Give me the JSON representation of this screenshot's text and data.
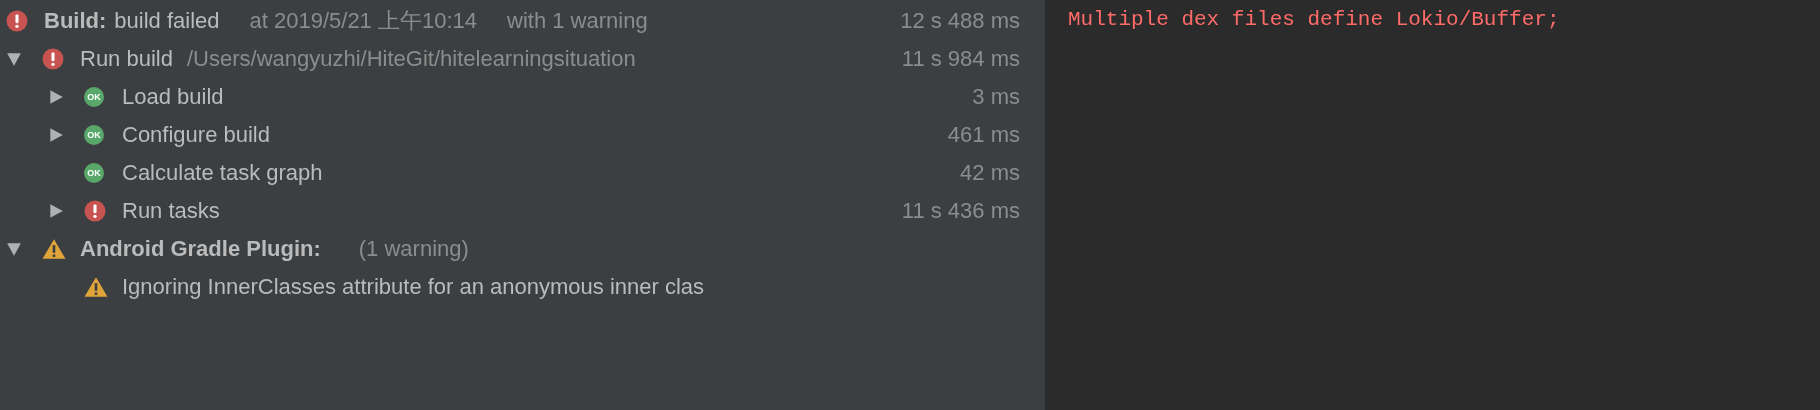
{
  "build_tree": {
    "kind": "error",
    "title": "Build:",
    "label": "build failed",
    "details": [
      "at 2019/5/21 上午10:14",
      "with 1 warning"
    ],
    "time": "12 s 488 ms",
    "children": [
      {
        "kind": "error",
        "expanded": true,
        "label": "Run build",
        "details": [
          "/Users/wangyuzhi/HiteGit/hitelearningsituation"
        ],
        "time": "11 s 984 ms",
        "children": [
          {
            "kind": "ok",
            "badge": "OK",
            "expanded": false,
            "label": "Load build",
            "time": "3 ms"
          },
          {
            "kind": "ok",
            "badge": "OK",
            "expanded": false,
            "label": "Configure build",
            "time": "461 ms"
          },
          {
            "kind": "ok",
            "badge": "OK",
            "label": "Calculate task graph",
            "time": "42 ms"
          },
          {
            "kind": "error",
            "expanded": false,
            "label": "Run tasks",
            "time": "11 s 436 ms"
          }
        ]
      },
      {
        "kind": "warning",
        "expanded": true,
        "title": "Android Gradle Plugin:",
        "details": [
          "(1 warning)"
        ],
        "children": [
          {
            "kind": "warning",
            "label": "Ignoring InnerClasses attribute for an anonymous inner clas"
          }
        ]
      }
    ]
  },
  "console": {
    "lines": [
      "Multiple dex files define Lokio/Buffer;"
    ]
  }
}
